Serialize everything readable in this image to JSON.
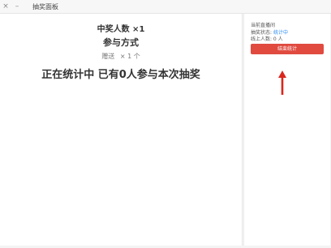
{
  "window": {
    "title": "抽奖面板",
    "close_glyph": "×",
    "minimize_glyph": "–"
  },
  "main": {
    "winners_count": "中奖人数 ×1",
    "participation_title": "参与方式",
    "gift_label": "赠送",
    "gift_multiplier": "× 1 个",
    "status_text": "正在统计中 已有0人参与本次抽奖"
  },
  "sidebar": {
    "row1": "当前直播间",
    "row2_label": "抽奖状态:",
    "row2_value": "统计中",
    "row3": "线上人数: 0 人",
    "end_button_label": "结束统计"
  },
  "colors": {
    "accent_red": "#e04a3f",
    "status_blue": "#2f8df3"
  },
  "icons": {
    "annotation_arrow": "arrow-up-icon"
  }
}
